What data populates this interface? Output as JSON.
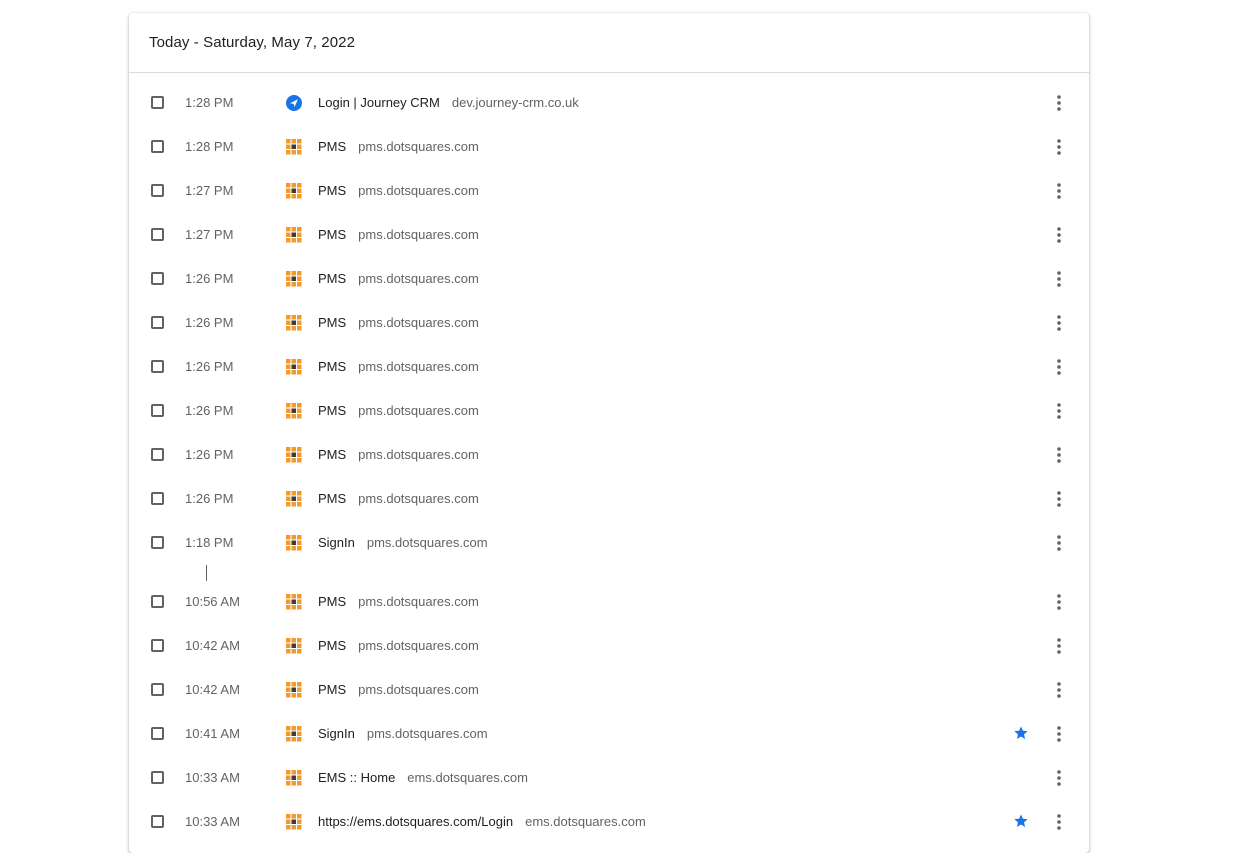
{
  "header": {
    "title": "Today - Saturday, May 7, 2022"
  },
  "colors": {
    "star": "#1a73e8",
    "journey_icon": "#1a73e8",
    "pms_icon": "#f19b2c"
  },
  "entries": [
    {
      "time": "1:28 PM",
      "title": "Login | Journey CRM",
      "domain": "dev.journey-crm.co.uk",
      "icon": "journey-crm-icon",
      "starred": false
    },
    {
      "time": "1:28 PM",
      "title": "PMS",
      "domain": "pms.dotsquares.com",
      "icon": "dotsquares-icon",
      "starred": false
    },
    {
      "time": "1:27 PM",
      "title": "PMS",
      "domain": "pms.dotsquares.com",
      "icon": "dotsquares-icon",
      "starred": false
    },
    {
      "time": "1:27 PM",
      "title": "PMS",
      "domain": "pms.dotsquares.com",
      "icon": "dotsquares-icon",
      "starred": false
    },
    {
      "time": "1:26 PM",
      "title": "PMS",
      "domain": "pms.dotsquares.com",
      "icon": "dotsquares-icon",
      "starred": false
    },
    {
      "time": "1:26 PM",
      "title": "PMS",
      "domain": "pms.dotsquares.com",
      "icon": "dotsquares-icon",
      "starred": false
    },
    {
      "time": "1:26 PM",
      "title": "PMS",
      "domain": "pms.dotsquares.com",
      "icon": "dotsquares-icon",
      "starred": false
    },
    {
      "time": "1:26 PM",
      "title": "PMS",
      "domain": "pms.dotsquares.com",
      "icon": "dotsquares-icon",
      "starred": false
    },
    {
      "time": "1:26 PM",
      "title": "PMS",
      "domain": "pms.dotsquares.com",
      "icon": "dotsquares-icon",
      "starred": false
    },
    {
      "time": "1:26 PM",
      "title": "PMS",
      "domain": "pms.dotsquares.com",
      "icon": "dotsquares-icon",
      "starred": false
    },
    {
      "time": "1:18 PM",
      "title": "SignIn",
      "domain": "pms.dotsquares.com",
      "icon": "dotsquares-icon",
      "starred": false
    },
    {
      "time": "10:56 AM",
      "title": "PMS",
      "domain": "pms.dotsquares.com",
      "icon": "dotsquares-icon",
      "starred": false
    },
    {
      "time": "10:42 AM",
      "title": "PMS",
      "domain": "pms.dotsquares.com",
      "icon": "dotsquares-icon",
      "starred": false
    },
    {
      "time": "10:42 AM",
      "title": "PMS",
      "domain": "pms.dotsquares.com",
      "icon": "dotsquares-icon",
      "starred": false
    },
    {
      "time": "10:41 AM",
      "title": "SignIn",
      "domain": "pms.dotsquares.com",
      "icon": "dotsquares-icon",
      "starred": true
    },
    {
      "time": "10:33 AM",
      "title": "EMS :: Home",
      "domain": "ems.dotsquares.com",
      "icon": "dotsquares-icon",
      "starred": false
    },
    {
      "time": "10:33 AM",
      "title": "https://ems.dotsquares.com/Login",
      "domain": "ems.dotsquares.com",
      "icon": "dotsquares-icon",
      "starred": true
    }
  ]
}
